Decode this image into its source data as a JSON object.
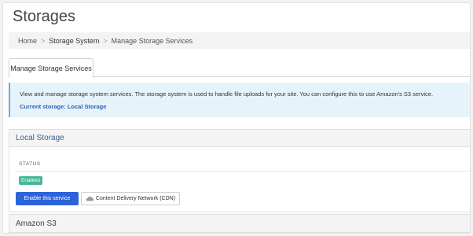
{
  "page": {
    "title": "Storages"
  },
  "breadcrumb": {
    "items": [
      "Home",
      "Storage System",
      "Manage Storage Services"
    ],
    "separator": ">"
  },
  "tabs": [
    {
      "label": "Manage Storage Services"
    }
  ],
  "info": {
    "description": "View and manage storage system services. The storage system is used to handle file uploads for your site. You can configure this to use Amazon's S3 service.",
    "current_storage": "Current storage: Local Storage"
  },
  "services": {
    "local": {
      "title": "Local Storage",
      "status_label": "STATUS",
      "status_badge": "Enabled",
      "enable_button": "Enable this service",
      "cdn_button": "Content Delivery Network (CDN)",
      "cdn_icon": "cloud-icon"
    },
    "s3": {
      "title": "Amazon S3"
    }
  },
  "colors": {
    "primary": "#2c63d9",
    "badge": "#49b597",
    "info_bg": "#e7f3fb",
    "info_border": "#5ab3dd",
    "link": "#2a63b3"
  }
}
